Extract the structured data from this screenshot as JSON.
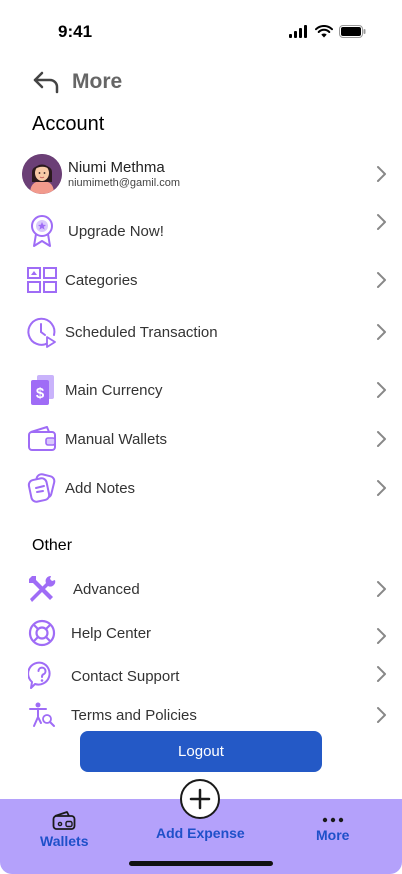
{
  "status_bar": {
    "time": "9:41"
  },
  "header": {
    "title": "More"
  },
  "sections": {
    "account": "Account",
    "other": "Other"
  },
  "profile": {
    "name": "Niumi Methma",
    "email": "niumimeth@gamil.com"
  },
  "account_items": [
    {
      "label": "Upgrade Now!",
      "icon": "badge-icon"
    },
    {
      "label": "Categories",
      "icon": "grid-icon"
    },
    {
      "label": "Scheduled Transaction",
      "icon": "clock-play-icon"
    },
    {
      "label": "Main Currency",
      "icon": "currency-icon"
    },
    {
      "label": "Manual Wallets",
      "icon": "wallet-icon"
    },
    {
      "label": "Add Notes",
      "icon": "notes-icon"
    }
  ],
  "other_items": [
    {
      "label": "Advanced",
      "icon": "tools-icon"
    },
    {
      "label": "Help Center",
      "icon": "lifebuoy-icon"
    },
    {
      "label": "Contact Support",
      "icon": "question-icon"
    },
    {
      "label": "Terms and Policies",
      "icon": "accessibility-search-icon"
    }
  ],
  "logout_label": "Logout",
  "bottom_nav": {
    "wallets": "Wallets",
    "add_expense": "Add Expense",
    "more": "More"
  },
  "colors": {
    "accent_purple": "#9f6cf6",
    "nav_bg": "#b4a1fb",
    "primary_blue": "#2459c6"
  }
}
